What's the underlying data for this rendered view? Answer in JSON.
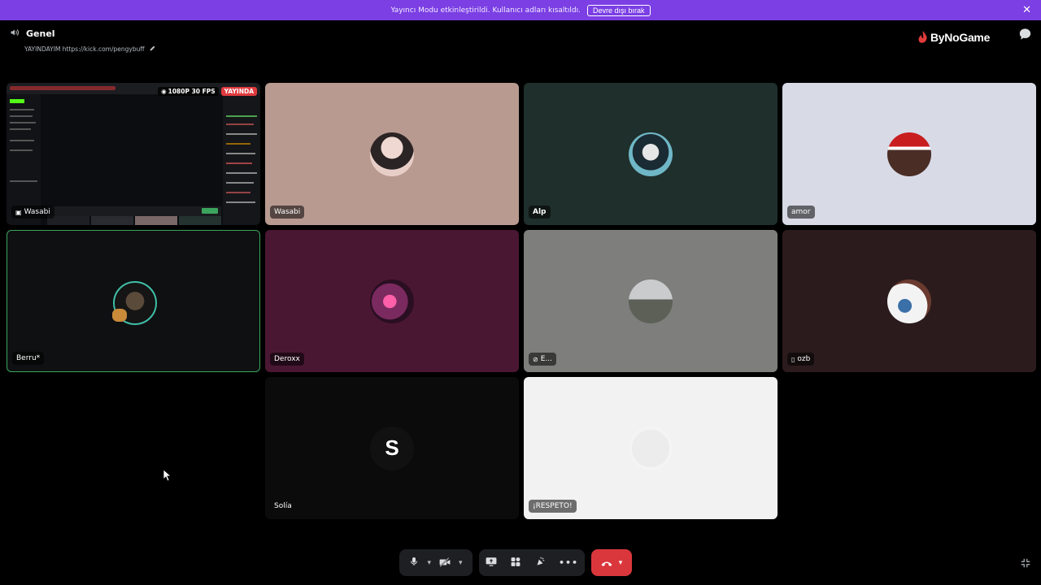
{
  "banner": {
    "message": "Yayıncı Modu etkinleştirildi. Kullanıcı adları kısaltıldı.",
    "button_label": "Devre dışı bırak"
  },
  "channel": {
    "name": "Genel",
    "status": "YAYINDAYIM https://kick.com/pengybuff"
  },
  "brand": {
    "name": "ByNoGame"
  },
  "stream": {
    "quality_badge": "1080P 30 FPS",
    "live_badge": "YAYINDA"
  },
  "tiles": [
    {
      "name": "Wasabi",
      "type": "stream"
    },
    {
      "name": "Wasabi",
      "bg": "#b89a91"
    },
    {
      "name": "Alp",
      "bg": "#1f2f2b"
    },
    {
      "name": "amor",
      "bg": "#d8dae6"
    },
    {
      "name": "Berru*",
      "bg": "#0f1011",
      "speaking": true
    },
    {
      "name": "Deroxx",
      "bg": "#4a1733"
    },
    {
      "name": "E...",
      "bg": "#7e7e7c",
      "icon": "stream-icon"
    },
    {
      "name": "ozb",
      "bg": "#2b1b1d",
      "icon": "mobile-icon"
    },
    {
      "name": "Solía",
      "bg": "#0b0b0b",
      "initial": "S"
    },
    {
      "name": "¡RESPETO!",
      "bg": "#f2f2f2"
    }
  ],
  "icons": [
    "speaker-icon",
    "pencil-icon",
    "chat-icon",
    "microphone-icon",
    "camera-off-icon",
    "screen-share-icon",
    "activities-icon",
    "soundboard-icon",
    "more-icon",
    "hang-up-icon",
    "minimize-icon"
  ],
  "colors": {
    "banner": "#7b3fe4",
    "speaking": "#3ba55d",
    "hangup": "#da373c",
    "live": "#e03a3e"
  }
}
